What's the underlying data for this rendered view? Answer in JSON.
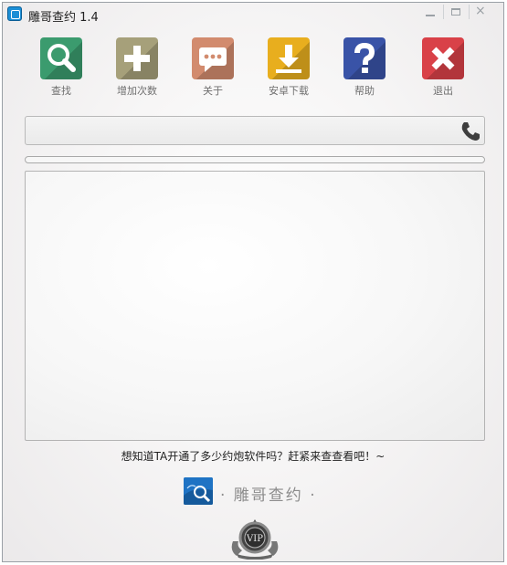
{
  "window": {
    "title": "雕哥查约 1.4",
    "controls": {
      "minimize": "minimize",
      "maximize": "maximize",
      "close": "×"
    }
  },
  "toolbar": {
    "items": [
      {
        "label": "查找",
        "icon": "search-icon",
        "color": "#3b9b6e"
      },
      {
        "label": "增加次数",
        "icon": "plus-icon",
        "color": "#a6a07a"
      },
      {
        "label": "关于",
        "icon": "chat-bubble-icon",
        "color": "#d28b6e"
      },
      {
        "label": "安卓下载",
        "icon": "download-icon",
        "color": "#e8ae1e"
      },
      {
        "label": "帮助",
        "icon": "question-icon",
        "color": "#3953a7"
      },
      {
        "label": "退出",
        "icon": "close-x-icon",
        "color": "#d94148"
      }
    ]
  },
  "phone_input": {
    "value": "",
    "placeholder": "",
    "icon": "phone-icon"
  },
  "progress": {
    "value": 0
  },
  "result": {
    "text": ""
  },
  "tagline": "想知道TA开通了多少约炮软件吗？赶紧来查查看吧！~",
  "brand": {
    "logo": "brand-logo",
    "text": "· 雕哥查约 ·",
    "badge_icon": "vip-badge-icon",
    "badge_text": "VIP"
  }
}
